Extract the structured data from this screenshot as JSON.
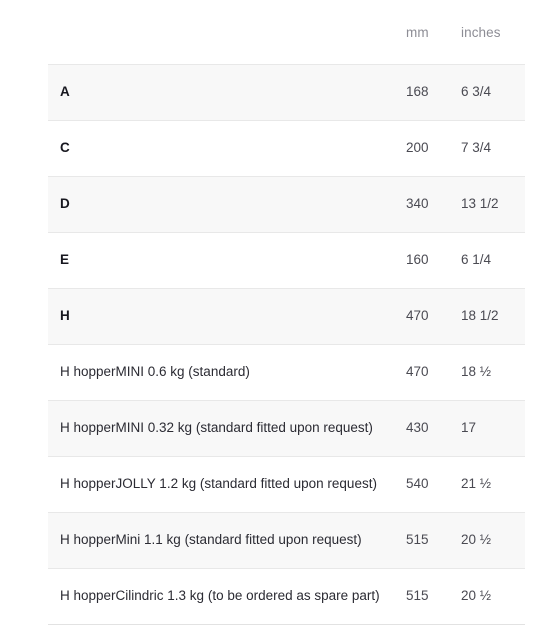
{
  "table": {
    "headers": {
      "label": "",
      "mm": "mm",
      "inches": "inches"
    },
    "rows": [
      {
        "label": "A",
        "mm": "168",
        "inches": "6 3/4",
        "bold": true
      },
      {
        "label": "C",
        "mm": "200",
        "inches": "7 3/4",
        "bold": true
      },
      {
        "label": "D",
        "mm": "340",
        "inches": "13 1/2",
        "bold": true
      },
      {
        "label": "E",
        "mm": "160",
        "inches": "6 1/4",
        "bold": true
      },
      {
        "label": "H",
        "mm": "470",
        "inches": "18 1/2",
        "bold": true
      },
      {
        "label": "H hopperMINI 0.6 kg (standard)",
        "mm": "470",
        "inches": "18 ½",
        "bold": false
      },
      {
        "label": "H hopperMINI 0.32 kg (standard fitted upon request)",
        "mm": "430",
        "inches": "17",
        "bold": false
      },
      {
        "label": "H hopperJOLLY 1.2 kg (standard fitted upon request)",
        "mm": "540",
        "inches": "21 ½",
        "bold": false
      },
      {
        "label": "H hopperMini 1.1 kg (standard fitted upon request)",
        "mm": "515",
        "inches": "20 ½",
        "bold": false
      },
      {
        "label": "H hopperCilindric 1.3 kg (to be ordered as spare part)",
        "mm": "515",
        "inches": "20 ½",
        "bold": false
      }
    ]
  },
  "colors": {
    "stripe_background": "#f8f8f8",
    "row_background": "#ffffff",
    "row_border": "#e8e8e8",
    "header_text": "#8d8d95",
    "value_text": "#4a4a52",
    "key_text": "#17171f"
  }
}
